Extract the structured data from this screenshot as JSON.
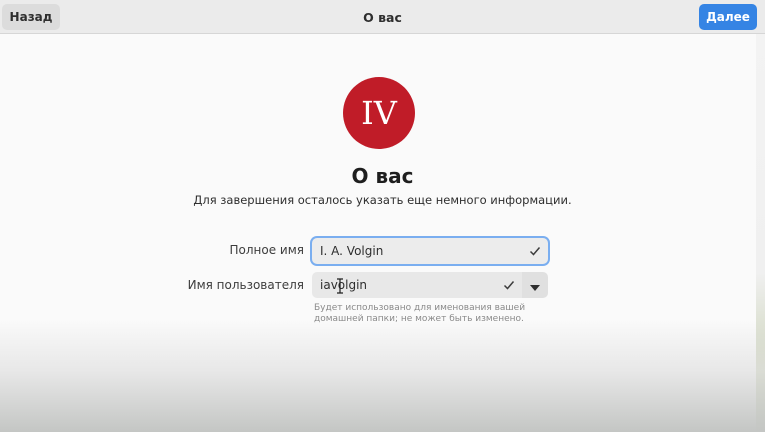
{
  "header": {
    "back_label": "Назад",
    "title": "О вас",
    "next_label": "Далее"
  },
  "avatar": {
    "initials": "IV",
    "color": "#c01c28"
  },
  "main": {
    "heading": "О вас",
    "subtitle": "Для завершения осталось указать еще немного информации."
  },
  "form": {
    "full_name_label": "Полное имя",
    "full_name_value": "I. A. Volgin",
    "username_label": "Имя пользователя",
    "username_value": "iavolgin",
    "username_hint": "Будет использовано для именования вашей домашней папки; не может быть изменено."
  },
  "colors": {
    "accent": "#3584e4",
    "focus_ring": "#7aaef0"
  }
}
